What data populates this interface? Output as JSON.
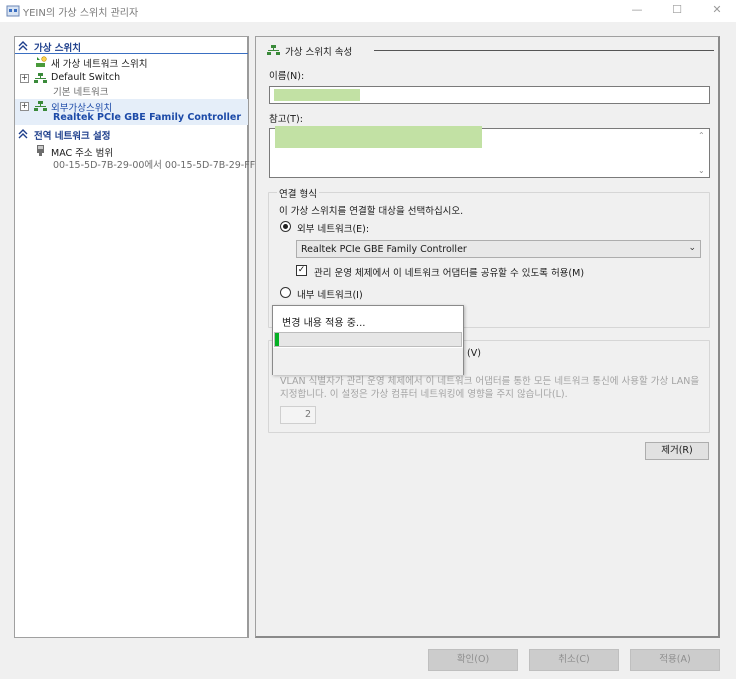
{
  "window": {
    "title": "YEIN의 가상 스위치 관리자",
    "minimize_glyph": "—",
    "maximize_glyph": "☐",
    "close_glyph": "✕"
  },
  "tree": {
    "virtual_switches_header": "가상 스위치",
    "new_switch_label": "새 가상 네트워크 스위치",
    "default_switch": {
      "label": "Default Switch",
      "sub": "기본 네트워크"
    },
    "external_switch": {
      "label": "외부가상스위치",
      "sub": "Realtek PCIe GBE Family Controller"
    },
    "global_header": "전역 네트워크 설정",
    "mac_range": {
      "label": "MAC 주소 범위",
      "sub": "00-15-5D-7B-29-00에서 00-15-5D-7B-29-FF"
    },
    "expander_glyph": "+"
  },
  "props": {
    "section_title": "가상 스위치 속성",
    "name_label": "이름(N):",
    "notes_label": "참고(T):",
    "connection_type": {
      "title": "연결 형식",
      "instruction": "이 가상 스위치를 연결할 대상을 선택하십시오.",
      "external_label": "외부 네트워크(E):",
      "external_selected": true,
      "adapter_value": "Realtek PCIe GBE Family Controller",
      "share_label": "관리 운영 체제에서 이 네트워크 어댑터를 공유할 수 있도록 허용(M)",
      "share_checked": true,
      "internal_label": "내부 네트워크(I)",
      "internal_selected": false
    },
    "vlan": {
      "title_suffix": "(V)",
      "description": "VLAN 식별자가 관리 운영 체제에서 이 네트워크 어댑터를 통한 모든 네트워크 통신에 사용할 가상 LAN을 지정합니다. 이 설정은 가상 컴퓨터 네트워킹에 영향을 주지 않습니다(L).",
      "vlan_id": "2"
    },
    "remove_button": "제거(R)"
  },
  "footer": {
    "ok": "확인(O)",
    "cancel": "취소(C)",
    "apply": "적용(A)"
  },
  "popup": {
    "message": "변경 내용 적용 중...",
    "progress": 0.02
  },
  "colors": {
    "accent": "#1e3f8c",
    "progress": "#06b025"
  }
}
